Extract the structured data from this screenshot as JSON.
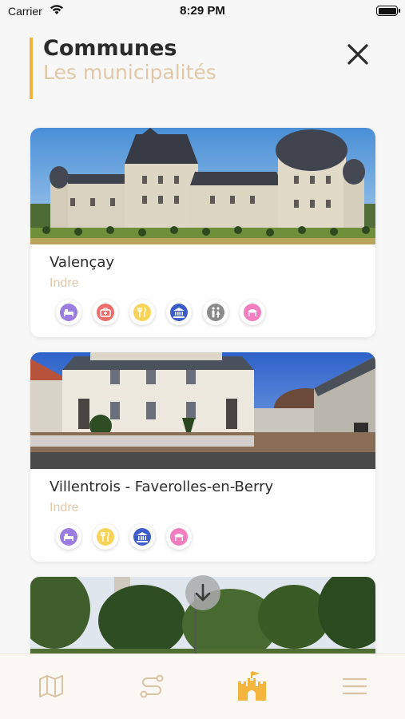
{
  "status": {
    "carrier": "Carrier",
    "time": "8:29 PM"
  },
  "header": {
    "title": "Communes",
    "subtitle": "Les municipalités"
  },
  "cards": [
    {
      "name": "Valençay",
      "dept": "Indre",
      "icons": [
        "bed-icon",
        "health-icon",
        "restaurant-icon",
        "museum-icon",
        "toilets-icon",
        "market-icon"
      ]
    },
    {
      "name": "Villentrois - Faverolles-en-Berry",
      "dept": "Indre",
      "icons": [
        "bed-icon",
        "restaurant-icon",
        "museum-icon",
        "market-icon"
      ]
    },
    {
      "name": "",
      "dept": "",
      "icons": []
    }
  ],
  "colors": {
    "accent": "#f4b53f",
    "bed": "#9b7fe0",
    "health": "#ec6c6c",
    "restaurant": "#f7d35a",
    "museum": "#3b5cc9",
    "toilets": "#8a8a8a",
    "market": "#f27dbf"
  },
  "tabs": [
    "map-icon",
    "route-icon",
    "castle-icon",
    "menu-icon"
  ],
  "active_tab": "castle-icon"
}
